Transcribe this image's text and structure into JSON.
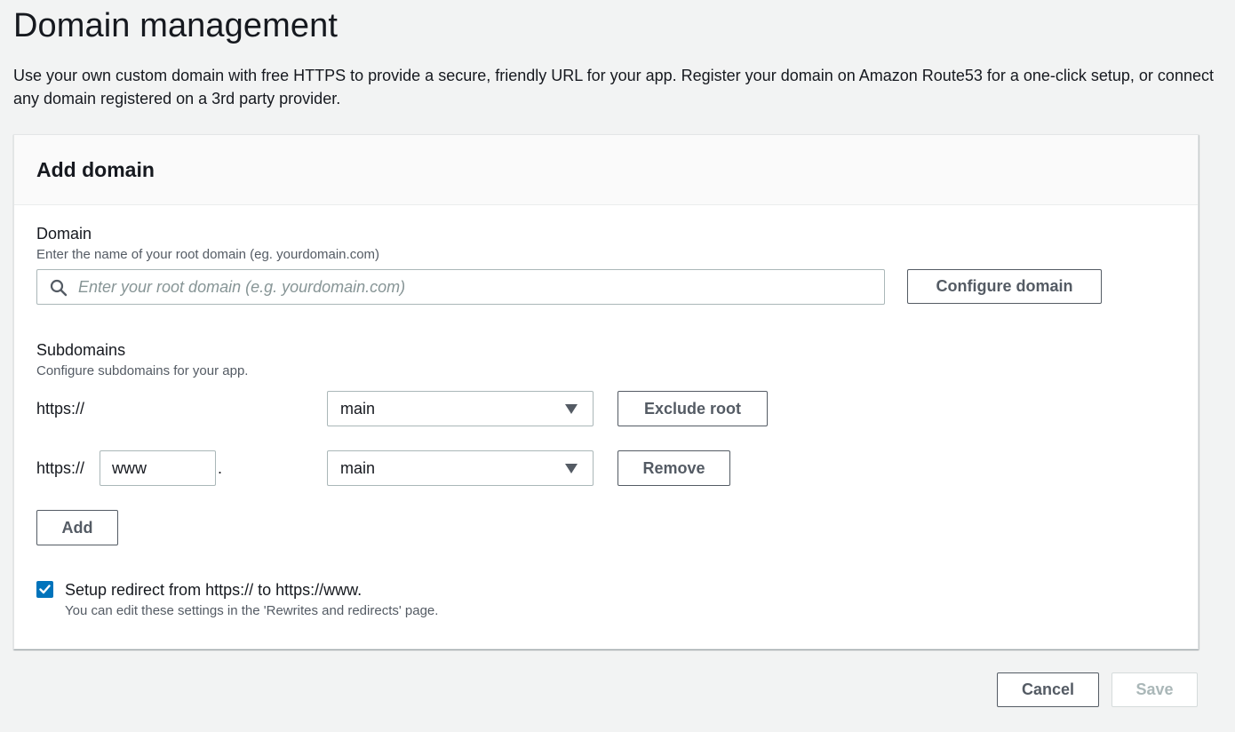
{
  "page": {
    "title": "Domain management",
    "description": "Use your own custom domain with free HTTPS to provide a secure, friendly URL for your app. Register your domain on Amazon Route53 for a one-click setup, or connect any domain registered on a 3rd party provider."
  },
  "panel": {
    "title": "Add domain",
    "domain": {
      "label": "Domain",
      "hint": "Enter the name of your root domain (eg. yourdomain.com)",
      "input_placeholder": "Enter your root domain (e.g. yourdomain.com)",
      "input_value": "",
      "search_icon": "search-icon",
      "configure_label": "Configure domain"
    },
    "subdomains": {
      "label": "Subdomains",
      "hint": "Configure subdomains for your app.",
      "rows": [
        {
          "prefix": "https://",
          "subdomain": "",
          "separator": "",
          "branch": "main",
          "action_label": "Exclude root"
        },
        {
          "prefix": "https://",
          "subdomain": "www",
          "separator": ".",
          "branch": "main",
          "action_label": "Remove"
        }
      ],
      "add_label": "Add"
    },
    "redirect": {
      "checked": true,
      "label": "Setup redirect from https:// to https://www.",
      "hint": "You can edit these settings in the 'Rewrites and redirects' page."
    }
  },
  "footer": {
    "cancel_label": "Cancel",
    "save_label": "Save"
  },
  "colors": {
    "background": "#f2f3f3",
    "accent": "#0073bb",
    "button_text": "#545b64",
    "disabled_text": "#aab7b8"
  }
}
